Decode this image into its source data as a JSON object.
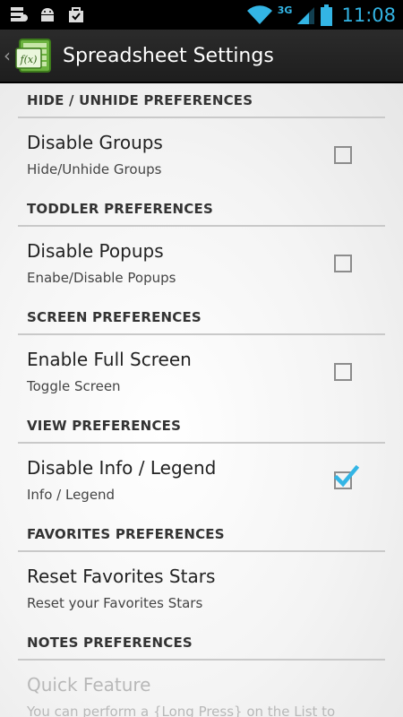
{
  "status_bar": {
    "network": "3G",
    "time": "11:08",
    "accent": "#33b5e5"
  },
  "action_bar": {
    "title": "Spreadsheet Settings",
    "app_icon_text": "f(x)"
  },
  "sections": [
    {
      "category": "HIDE / UNHIDE PREFERENCES",
      "title": "Disable Groups",
      "summary": "Hide/Unhide Groups",
      "checked": false
    },
    {
      "category": "TODDLER PREFERENCES",
      "title": "Disable Popups",
      "summary": "Enabe/Disable Popups",
      "checked": false
    },
    {
      "category": "SCREEN PREFERENCES",
      "title": "Enable Full Screen",
      "summary": "Toggle Screen",
      "checked": false
    },
    {
      "category": "VIEW PREFERENCES",
      "title": "Disable Info / Legend",
      "summary": "Info / Legend",
      "checked": true
    },
    {
      "category": "FAVORITES PREFERENCES",
      "title": "Reset Favorites Stars",
      "summary": "Reset your Favorites Stars"
    },
    {
      "category": "NOTES PREFERENCES",
      "title": "Quick Feature",
      "summary": "You can perform a {Long Press} on the List to"
    }
  ]
}
